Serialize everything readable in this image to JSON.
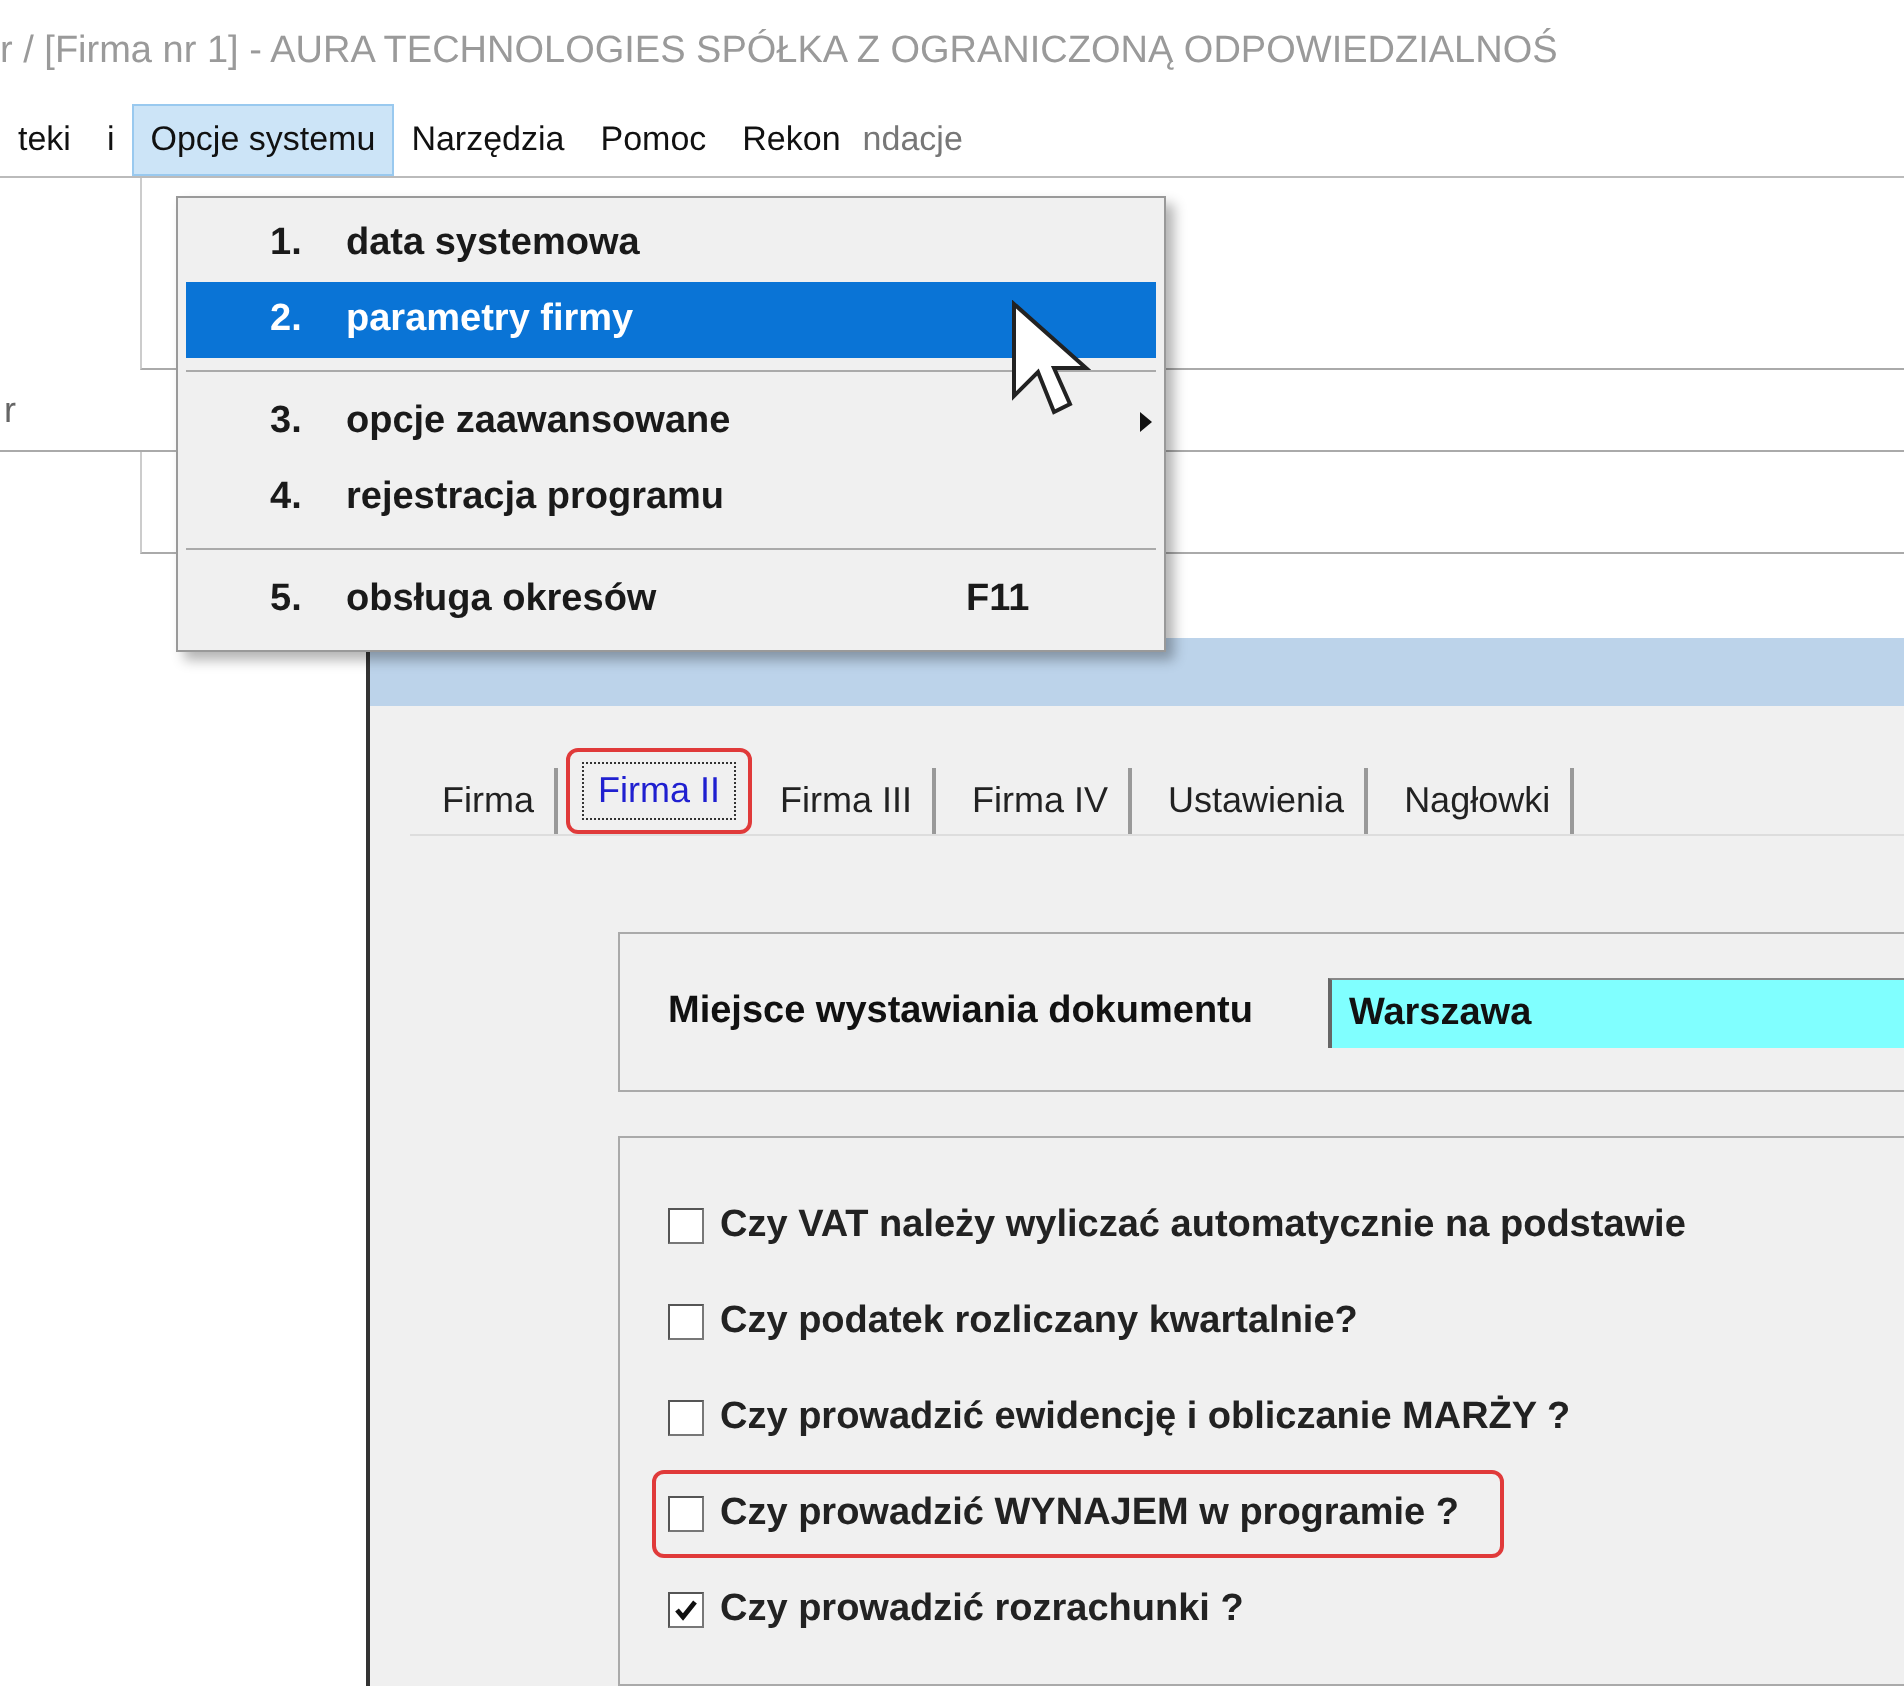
{
  "window": {
    "title": "r /  [Firma nr 1] - AURA TECHNOLOGIES SPÓŁKA Z OGRANICZONĄ ODPOWIEDZIALNOŚ"
  },
  "menu_bar": {
    "items": [
      {
        "label": "teki",
        "selected": false
      },
      {
        "label": "i",
        "selected": false
      },
      {
        "label": "Opcje systemu",
        "selected": true
      },
      {
        "label": "Narzędzia",
        "selected": false
      },
      {
        "label": "Pomoc",
        "selected": false
      },
      {
        "label": "Rekon",
        "selected": false
      }
    ],
    "trailing_fragment": "ndacje"
  },
  "background": {
    "side_fragment": "r"
  },
  "dropdown": {
    "items": [
      {
        "number": "1.",
        "label": "data systemowa",
        "selected": false,
        "submenu": false,
        "separator_after": false
      },
      {
        "number": "2.",
        "label": "parametry firmy",
        "selected": true,
        "submenu": false,
        "separator_after": true
      },
      {
        "number": "3.",
        "label": "opcje zaawansowane",
        "selected": false,
        "submenu": true,
        "separator_after": false
      },
      {
        "number": "4.",
        "label": "rejestracja programu",
        "selected": false,
        "submenu": false,
        "separator_after": true
      },
      {
        "number": "5.",
        "label": "obsługa okresów",
        "shortcut": "F11",
        "selected": false,
        "submenu": false,
        "separator_after": false
      }
    ]
  },
  "dialog": {
    "tabs": [
      {
        "label": "Firma",
        "selected": false,
        "highlighted": false
      },
      {
        "label": "Firma II",
        "selected": true,
        "highlighted": true
      },
      {
        "label": "Firma III",
        "selected": false,
        "highlighted": false
      },
      {
        "label": "Firma IV",
        "selected": false,
        "highlighted": false
      },
      {
        "label": "Ustawienia",
        "selected": false,
        "highlighted": false
      },
      {
        "label": "Nagłowki",
        "selected": false,
        "highlighted": false
      }
    ],
    "place": {
      "label": "Miejsce wystawiania dokumentu",
      "value": "Warszawa"
    },
    "options": [
      {
        "label": "Czy VAT należy wyliczać automatycznie na podstawie",
        "checked": false,
        "highlighted": false
      },
      {
        "label": "Czy podatek rozliczany kwartalnie?",
        "checked": false,
        "highlighted": false
      },
      {
        "label": "Czy prowadzić ewidencję i obliczanie MARŻY ?",
        "checked": false,
        "highlighted": false
      },
      {
        "label": "Czy prowadzić WYNAJEM w programie ?",
        "checked": false,
        "highlighted": true
      },
      {
        "label": "Czy prowadzić rozrachunki ?",
        "checked": true,
        "highlighted": false
      }
    ]
  }
}
